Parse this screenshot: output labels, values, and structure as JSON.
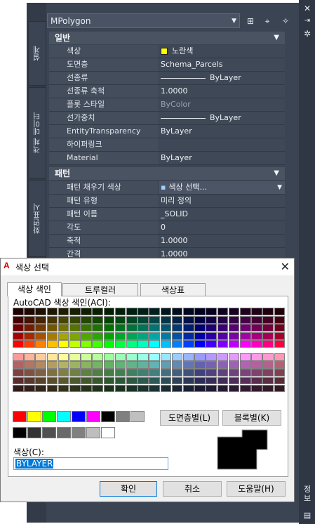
{
  "palette": {
    "object_type": "MPolygon",
    "side_tabs": [
      "설계",
      "객체 데이터",
      "화면표시"
    ],
    "right_buttons": [
      "close-icon",
      "auto-hide-icon",
      "settings-icon"
    ],
    "bottom_right_text": [
      "정",
      "보"
    ],
    "categories": {
      "general": "일반",
      "pattern": "패턴"
    },
    "general_rows": [
      {
        "label": "색상",
        "value": "노란색",
        "kind": "color",
        "color": "#ffff00"
      },
      {
        "label": "도면층",
        "value": "Schema_Parcels"
      },
      {
        "label": "선종류",
        "value": "ByLayer",
        "kind": "line"
      },
      {
        "label": "선종류 축척",
        "value": "1.0000"
      },
      {
        "label": "플롯 스타일",
        "value": "ByColor",
        "dim": true
      },
      {
        "label": "선가중치",
        "value": "ByLayer",
        "kind": "line"
      },
      {
        "label": "EntityTransparency",
        "value": "ByLayer"
      },
      {
        "label": "하이퍼링크",
        "value": ""
      },
      {
        "label": "Material",
        "value": "ByLayer"
      }
    ],
    "pattern_rows": [
      {
        "label": "패턴 채우기 색상",
        "value": "색상 선택...",
        "kind": "dropdown"
      },
      {
        "label": "패턴 유형",
        "value": "미리 정의"
      },
      {
        "label": "패턴 이름",
        "value": "_SOLID"
      },
      {
        "label": "각도",
        "value": "0"
      },
      {
        "label": "축척",
        "value": "1.0000"
      },
      {
        "label": "간격",
        "value": "1.0000"
      }
    ]
  },
  "dialog": {
    "title": "색상 선택",
    "logo": "A",
    "tabs": [
      "색상 색인",
      "트루컬러",
      "색상표"
    ],
    "aci_label": "AutoCAD 색상 색인(ACI):",
    "layer_button": "도면층별(L)",
    "block_button": "블록별(K)",
    "color_label": "색상(C):",
    "color_value": "BYLAYER",
    "ok_button": "확인",
    "cancel_button": "취소",
    "help_button": "도움말(H)",
    "standard_colors": [
      "#ff0000",
      "#ffff00",
      "#00ff00",
      "#00ffff",
      "#0000ff",
      "#ff00ff",
      "#000000",
      "#808080",
      "#c0c0c0"
    ],
    "gray_colors": [
      "#000000",
      "#333333",
      "#505050",
      "#696969",
      "#808080",
      "#bebebe",
      "#ffffff"
    ]
  }
}
